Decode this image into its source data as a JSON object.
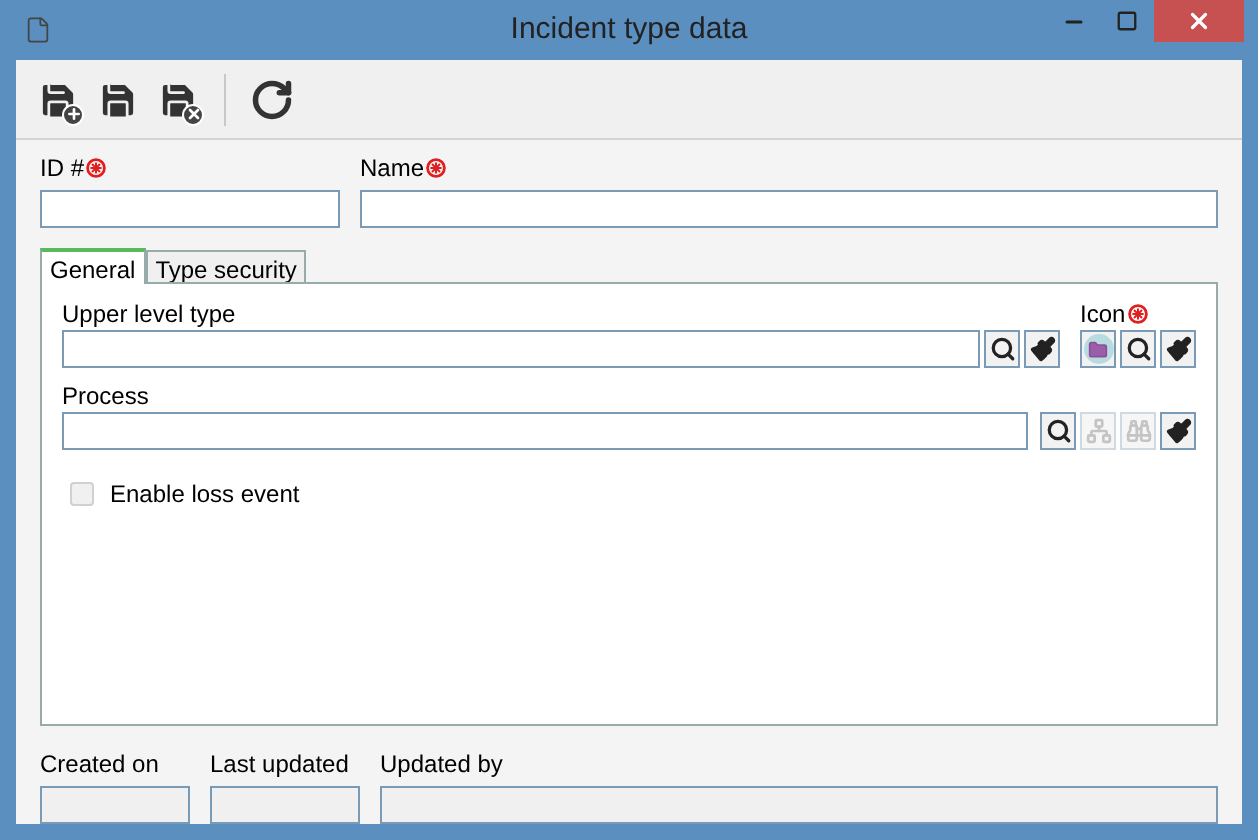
{
  "window": {
    "title": "Incident type data"
  },
  "toolbar": [
    {
      "kind": "save-new"
    },
    {
      "kind": "save"
    },
    {
      "kind": "save-close"
    },
    {
      "kind": "separator"
    },
    {
      "kind": "refresh"
    }
  ],
  "header_fields": [
    {
      "label": "ID #",
      "required": true
    },
    {
      "label": "Name",
      "required": true
    }
  ],
  "tabs": [
    {
      "label": "General",
      "selected": true
    },
    {
      "label": "Type security",
      "selected": false
    }
  ],
  "upper_level_type": {
    "label": "Upper level type",
    "buttons": [
      {
        "kind": "search",
        "disabled": false
      },
      {
        "kind": "clear",
        "disabled": false
      }
    ]
  },
  "icon": {
    "label": "Icon",
    "required": true,
    "buttons": [
      {
        "kind": "folder",
        "disabled": false
      },
      {
        "kind": "search",
        "disabled": false
      },
      {
        "kind": "clear",
        "disabled": false
      }
    ]
  },
  "process": {
    "label": "Process",
    "buttons": [
      {
        "kind": "search",
        "disabled": false
      },
      {
        "kind": "tree",
        "disabled": true
      },
      {
        "kind": "binoculars",
        "disabled": true
      },
      {
        "kind": "clear",
        "disabled": false
      }
    ]
  },
  "enable_loss_event": {
    "label": "Enable loss event",
    "checked": false
  },
  "footer_fields": [
    {
      "label": "Created on"
    },
    {
      "label": "Last updated"
    },
    {
      "label": "Updated by"
    }
  ]
}
